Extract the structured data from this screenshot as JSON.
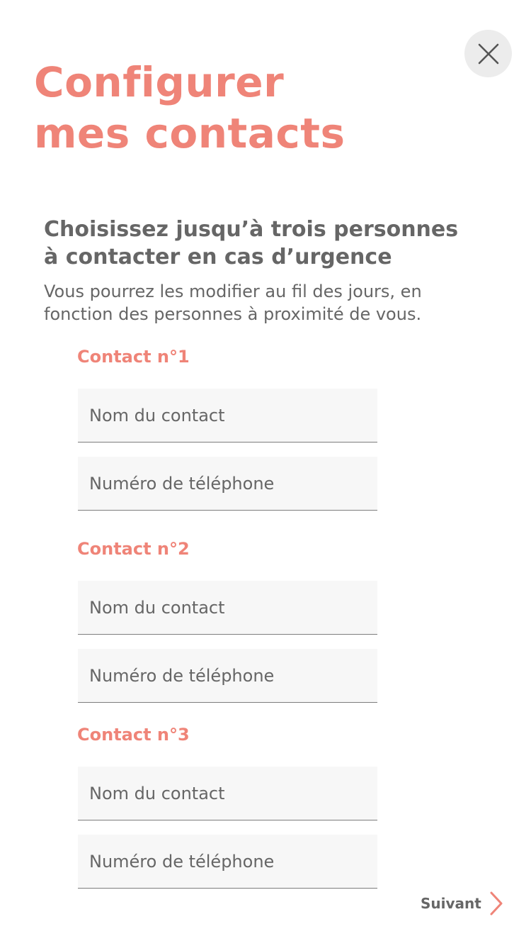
{
  "close": {
    "icon": "close-icon"
  },
  "title": {
    "line1": "Configurer",
    "line2": "mes contacts"
  },
  "heading": {
    "line1": "Choisissez jusqu’à trois personnes",
    "line2": "à contacter en cas d’urgence"
  },
  "subtext": {
    "line1": "Vous pourrez les modifier au fil des jours, en",
    "line2": "fonction des personnes à proximité de vous."
  },
  "contacts": [
    {
      "label": "Contact n°1",
      "name_placeholder": "Nom du contact",
      "phone_placeholder": "Numéro de téléphone"
    },
    {
      "label": "Contact n°2",
      "name_placeholder": "Nom du contact",
      "phone_placeholder": "Numéro de téléphone"
    },
    {
      "label": "Contact n°3",
      "name_placeholder": "Nom du contact",
      "phone_placeholder": "Numéro de téléphone"
    }
  ],
  "next": {
    "label": "Suivant",
    "icon": "chevron-right-icon"
  },
  "colors": {
    "accent": "#ef8478",
    "text": "#666666",
    "field_bg": "#f7f7f7",
    "close_bg": "#ececec"
  }
}
